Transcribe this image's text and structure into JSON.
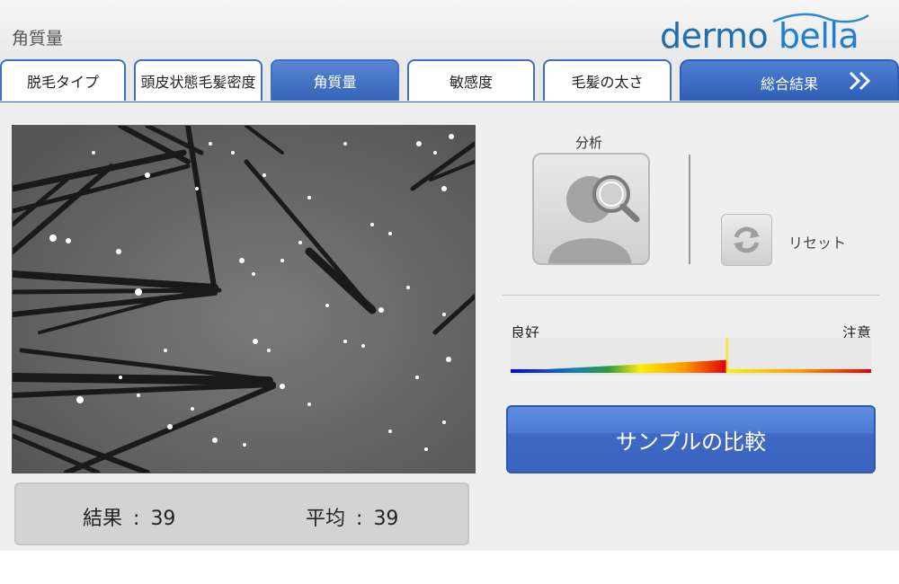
{
  "header": {
    "title": "角質量",
    "logo": {
      "part1": "dermo ",
      "part2": "bella"
    }
  },
  "tabs": [
    {
      "label": "脱毛タイプ",
      "active": false
    },
    {
      "label": "頭皮状態毛髪密度",
      "active": false
    },
    {
      "label": "角質量",
      "active": true
    },
    {
      "label": "敏感度",
      "active": false
    },
    {
      "label": "毛髪の太さ",
      "active": false
    },
    {
      "label": "総合結果",
      "active": false
    }
  ],
  "analysis": {
    "caption": "分析",
    "reset_label": "リセット"
  },
  "scale": {
    "good_label": "良好",
    "warn_label": "注意",
    "level": 0.6
  },
  "compare_button": {
    "label": "サンプルの比較"
  },
  "results": {
    "result_label": "結果",
    "result_value": "39",
    "average_label": "平均",
    "average_value": "39",
    "separator": ":"
  },
  "colors": {
    "tab_border": "#3d6fc4",
    "accent_blue": "#3a63c0",
    "logo_blue": "#1d6fb2"
  }
}
